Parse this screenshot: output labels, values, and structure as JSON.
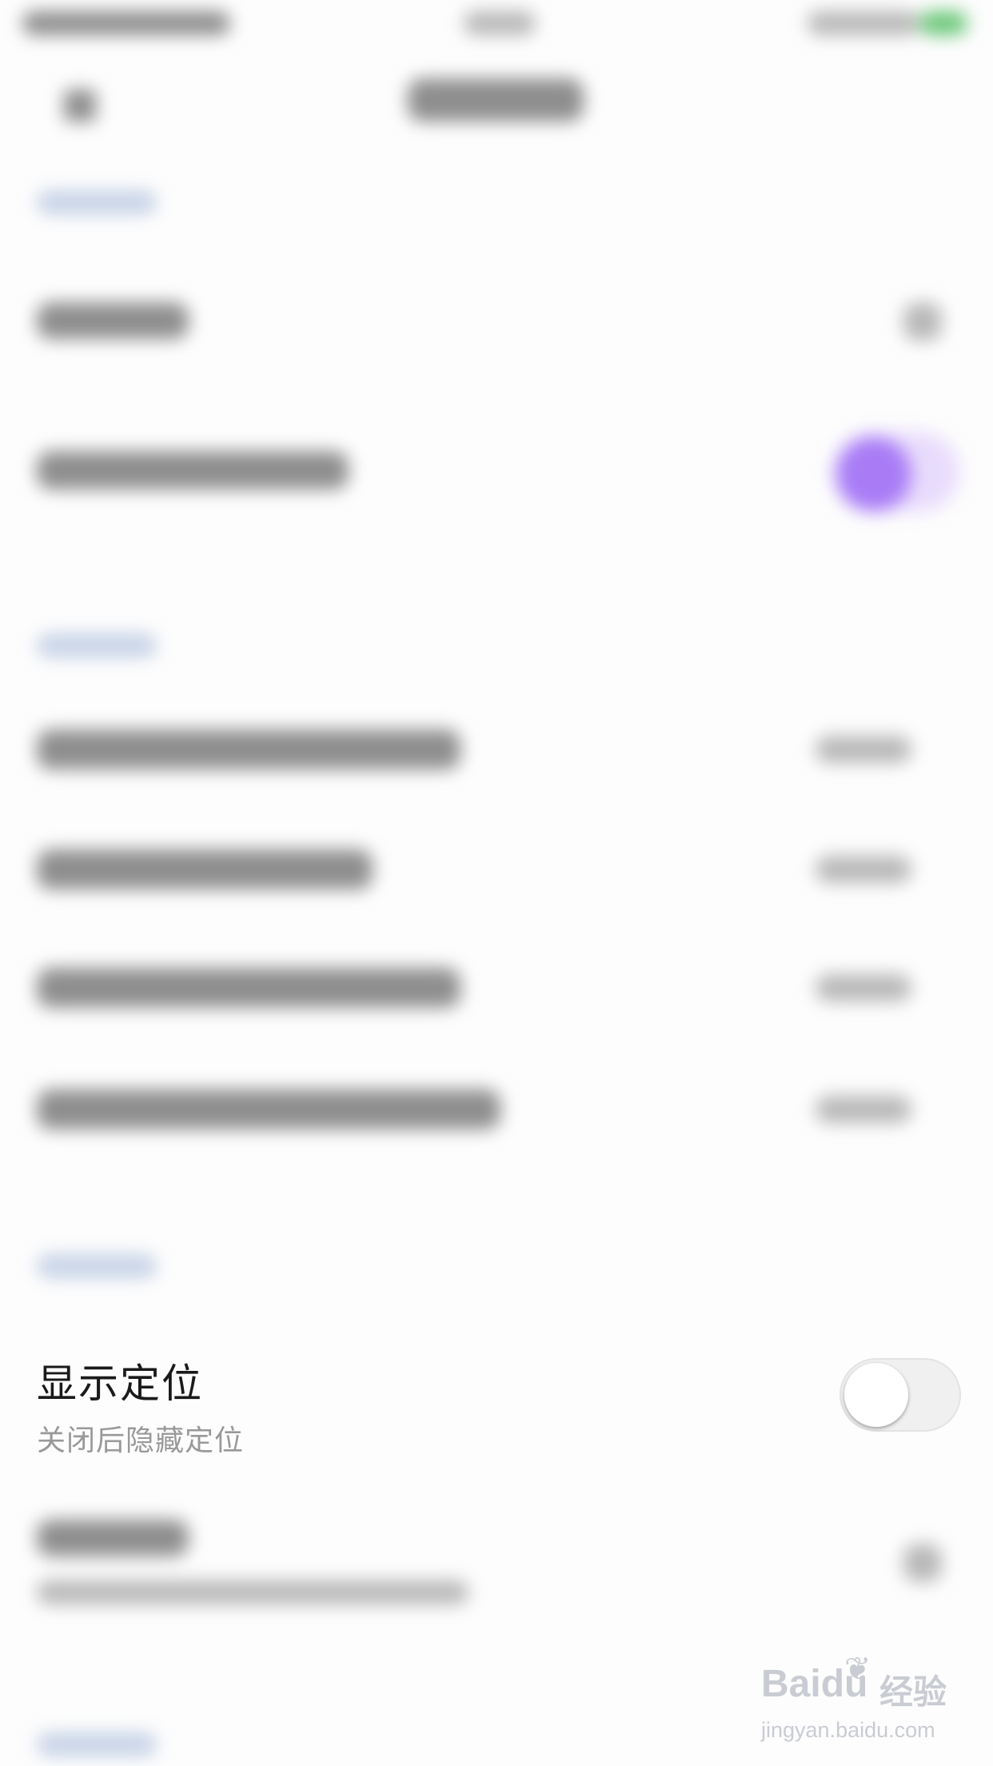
{
  "location_setting": {
    "title": "显示定位",
    "subtitle": "关闭后隐藏定位",
    "toggle_on": false
  },
  "watermark": {
    "logo": "Baidu",
    "logo_cn": "经验",
    "url": "jingyan.baidu.com"
  },
  "colors": {
    "background": "#fdfdfd",
    "title": "#1a1a1a",
    "subtitle": "#999999",
    "accent_purple": "#a97cf6",
    "toggle_track_off": "#f0f0f0"
  },
  "icons": [
    "back-arrow-icon",
    "chevron-right-icon",
    "paw-icon"
  ]
}
